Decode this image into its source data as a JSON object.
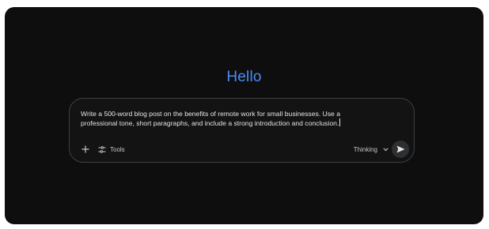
{
  "greeting": "Hello",
  "prompt": {
    "text": "Write a 500-word blog post on the benefits of remote work for small businesses. Use a\nprofessional tone, short paragraphs, and include a strong introduction and conclusion."
  },
  "toolbar": {
    "add_icon": "plus-icon",
    "tools_label": "Tools",
    "tools_icon": "tune-icon",
    "mode_label": "Thinking",
    "mode_icon": "chevron-down-icon",
    "send_icon": "send-icon"
  },
  "colors": {
    "background": "#0e0e0f",
    "accent": "#4a8cf6",
    "text": "#e3e3e3",
    "border": "#3c3f44"
  }
}
